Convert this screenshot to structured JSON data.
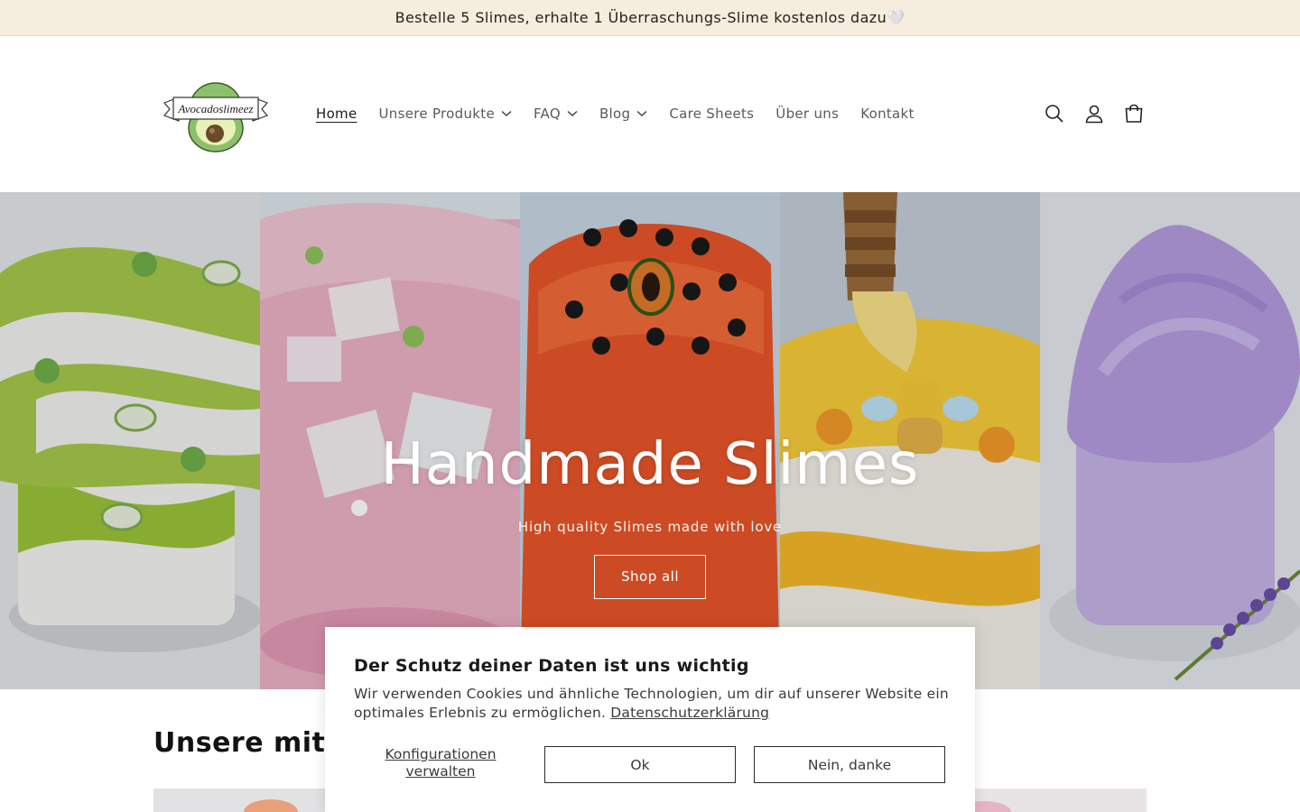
{
  "announcement": {
    "text": "Bestelle 5 Slimes, erhalte 1 Überraschungs-Slime kostenlos dazu🤍"
  },
  "header": {
    "logo_text": "Avocadoslimeez",
    "nav": [
      {
        "label": "Home",
        "active": true,
        "dropdown": false
      },
      {
        "label": "Unsere Produkte",
        "active": false,
        "dropdown": true
      },
      {
        "label": "FAQ",
        "active": false,
        "dropdown": true
      },
      {
        "label": "Blog",
        "active": false,
        "dropdown": true
      },
      {
        "label": "Care Sheets",
        "active": false,
        "dropdown": false
      },
      {
        "label": "Über uns",
        "active": false,
        "dropdown": false
      },
      {
        "label": "Kontakt",
        "active": false,
        "dropdown": false
      }
    ],
    "icons": [
      "search-icon",
      "account-icon",
      "cart-icon"
    ]
  },
  "hero": {
    "title": "Handmade Slimes",
    "subtitle": "High quality Slimes made with love",
    "button_label": "Shop all"
  },
  "section": {
    "title": "Unsere mit Li"
  },
  "cookie": {
    "title": "Der Schutz deiner Daten ist uns wichtig",
    "text": "Wir verwenden Cookies und ähnliche Technologien, um dir auf unserer Website ein optimales Erlebnis zu ermöglichen.",
    "privacy_link": "Datenschutzerklärung",
    "manage_label": "Konfigurationen verwalten",
    "ok_label": "Ok",
    "decline_label": "Nein, danke"
  },
  "colors": {
    "announcement_bg": "#f5eddd",
    "text": "#121212"
  }
}
